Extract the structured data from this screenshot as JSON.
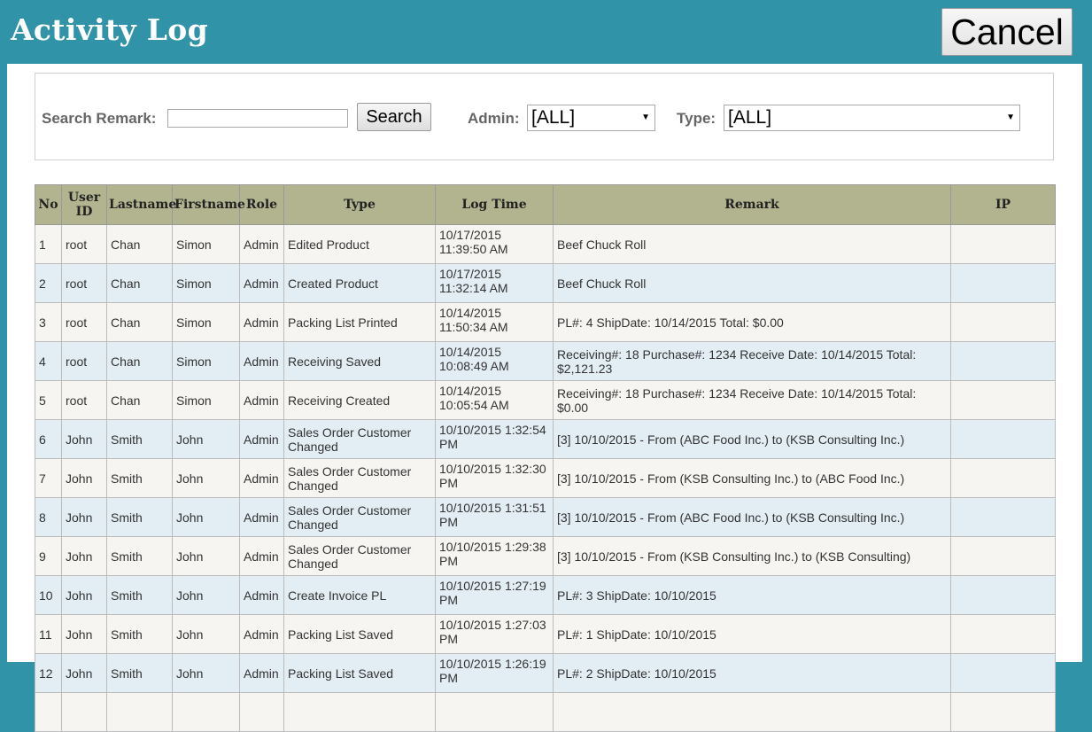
{
  "header": {
    "title": "Activity Log",
    "cancel_label": "Cancel",
    "background": "#3193a8"
  },
  "search": {
    "remark_label": "Search Remark:",
    "remark_value": "",
    "search_button": "Search",
    "admin_label": "Admin:",
    "admin_value": "[ALL]",
    "type_label": "Type:",
    "type_value": "[ALL]"
  },
  "table": {
    "columns": [
      "No",
      "User ID",
      "Lastname",
      "Firstname",
      "Role",
      "Type",
      "Log Time",
      "Remark",
      "IP"
    ],
    "header_color": "#b2b48f",
    "rows": [
      {
        "no": "1",
        "user_id": "root",
        "lastname": "Chan",
        "firstname": "Simon",
        "role": "Admin",
        "type": "Edited Product",
        "log_time": "10/17/2015 11:39:50 AM",
        "remark": "Beef Chuck Roll",
        "ip": ""
      },
      {
        "no": "2",
        "user_id": "root",
        "lastname": "Chan",
        "firstname": "Simon",
        "role": "Admin",
        "type": "Created Product",
        "log_time": "10/17/2015 11:32:14 AM",
        "remark": "Beef Chuck Roll",
        "ip": ""
      },
      {
        "no": "3",
        "user_id": "root",
        "lastname": "Chan",
        "firstname": "Simon",
        "role": "Admin",
        "type": "Packing List Printed",
        "log_time": "10/14/2015 11:50:34 AM",
        "remark": "PL#: 4 ShipDate: 10/14/2015 Total: $0.00",
        "ip": ""
      },
      {
        "no": "4",
        "user_id": "root",
        "lastname": "Chan",
        "firstname": "Simon",
        "role": "Admin",
        "type": "Receiving Saved",
        "log_time": "10/14/2015 10:08:49 AM",
        "remark": "Receiving#: 18 Purchase#: 1234 Receive Date: 10/14/2015 Total: $2,121.23",
        "ip": ""
      },
      {
        "no": "5",
        "user_id": "root",
        "lastname": "Chan",
        "firstname": "Simon",
        "role": "Admin",
        "type": "Receiving Created",
        "log_time": "10/14/2015 10:05:54 AM",
        "remark": "Receiving#: 18 Purchase#: 1234 Receive Date: 10/14/2015 Total: $0.00",
        "ip": ""
      },
      {
        "no": "6",
        "user_id": "John",
        "lastname": "Smith",
        "firstname": "John",
        "role": "Admin",
        "type": "Sales Order Customer Changed",
        "log_time": "10/10/2015 1:32:54 PM",
        "remark": "[3] 10/10/2015 - From (ABC Food Inc.) to (KSB Consulting Inc.)",
        "ip": ""
      },
      {
        "no": "7",
        "user_id": "John",
        "lastname": "Smith",
        "firstname": "John",
        "role": "Admin",
        "type": "Sales Order Customer Changed",
        "log_time": "10/10/2015 1:32:30 PM",
        "remark": "[3] 10/10/2015 - From (KSB Consulting Inc.) to (ABC Food Inc.)",
        "ip": ""
      },
      {
        "no": "8",
        "user_id": "John",
        "lastname": "Smith",
        "firstname": "John",
        "role": "Admin",
        "type": "Sales Order Customer Changed",
        "log_time": "10/10/2015 1:31:51 PM",
        "remark": "[3] 10/10/2015 - From (ABC Food Inc.) to (KSB Consulting Inc.)",
        "ip": ""
      },
      {
        "no": "9",
        "user_id": "John",
        "lastname": "Smith",
        "firstname": "John",
        "role": "Admin",
        "type": "Sales Order Customer Changed",
        "log_time": "10/10/2015 1:29:38 PM",
        "remark": "[3] 10/10/2015 - From (KSB Consulting Inc.) to (KSB Consulting)",
        "ip": ""
      },
      {
        "no": "10",
        "user_id": "John",
        "lastname": "Smith",
        "firstname": "John",
        "role": "Admin",
        "type": "Create Invoice PL",
        "log_time": "10/10/2015 1:27:19 PM",
        "remark": "PL#: 3 ShipDate: 10/10/2015",
        "ip": ""
      },
      {
        "no": "11",
        "user_id": "John",
        "lastname": "Smith",
        "firstname": "John",
        "role": "Admin",
        "type": "Packing List Saved",
        "log_time": "10/10/2015 1:27:03 PM",
        "remark": "PL#: 1 ShipDate: 10/10/2015",
        "ip": ""
      },
      {
        "no": "12",
        "user_id": "John",
        "lastname": "Smith",
        "firstname": "John",
        "role": "Admin",
        "type": "Packing List Saved",
        "log_time": "10/10/2015 1:26:19 PM",
        "remark": "PL#: 2 ShipDate: 10/10/2015",
        "ip": ""
      },
      {
        "no": "",
        "user_id": "",
        "lastname": "",
        "firstname": "",
        "role": "",
        "type": "",
        "log_time": "",
        "remark": "",
        "ip": ""
      }
    ]
  }
}
